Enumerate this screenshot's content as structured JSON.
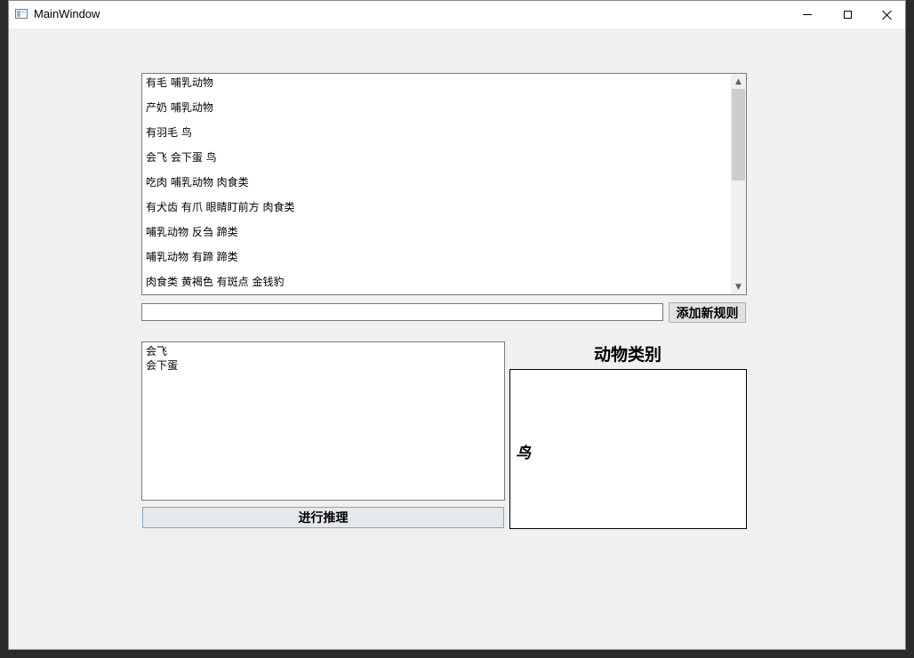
{
  "window": {
    "title": "MainWindow",
    "controls": [
      "minimize-icon",
      "maximize-icon",
      "close-icon"
    ]
  },
  "rules": {
    "items": [
      "有毛 哺乳动物",
      "产奶 哺乳动物",
      "有羽毛 鸟",
      "会飞 会下蛋 鸟",
      "吃肉 哺乳动物 肉食类",
      "有犬齿 有爪 眼睛盯前方 肉食类",
      "哺乳动物 反刍 蹄类",
      "哺乳动物 有蹄 蹄类",
      "肉食类 黄褐色 有斑点 金钱豹"
    ],
    "new_rule_value": "",
    "add_button_label": "添加新规则"
  },
  "facts": {
    "lines": [
      "会飞",
      "会下蛋"
    ]
  },
  "infer_button_label": "进行推理",
  "result": {
    "title": "动物类别",
    "value": "鸟"
  }
}
